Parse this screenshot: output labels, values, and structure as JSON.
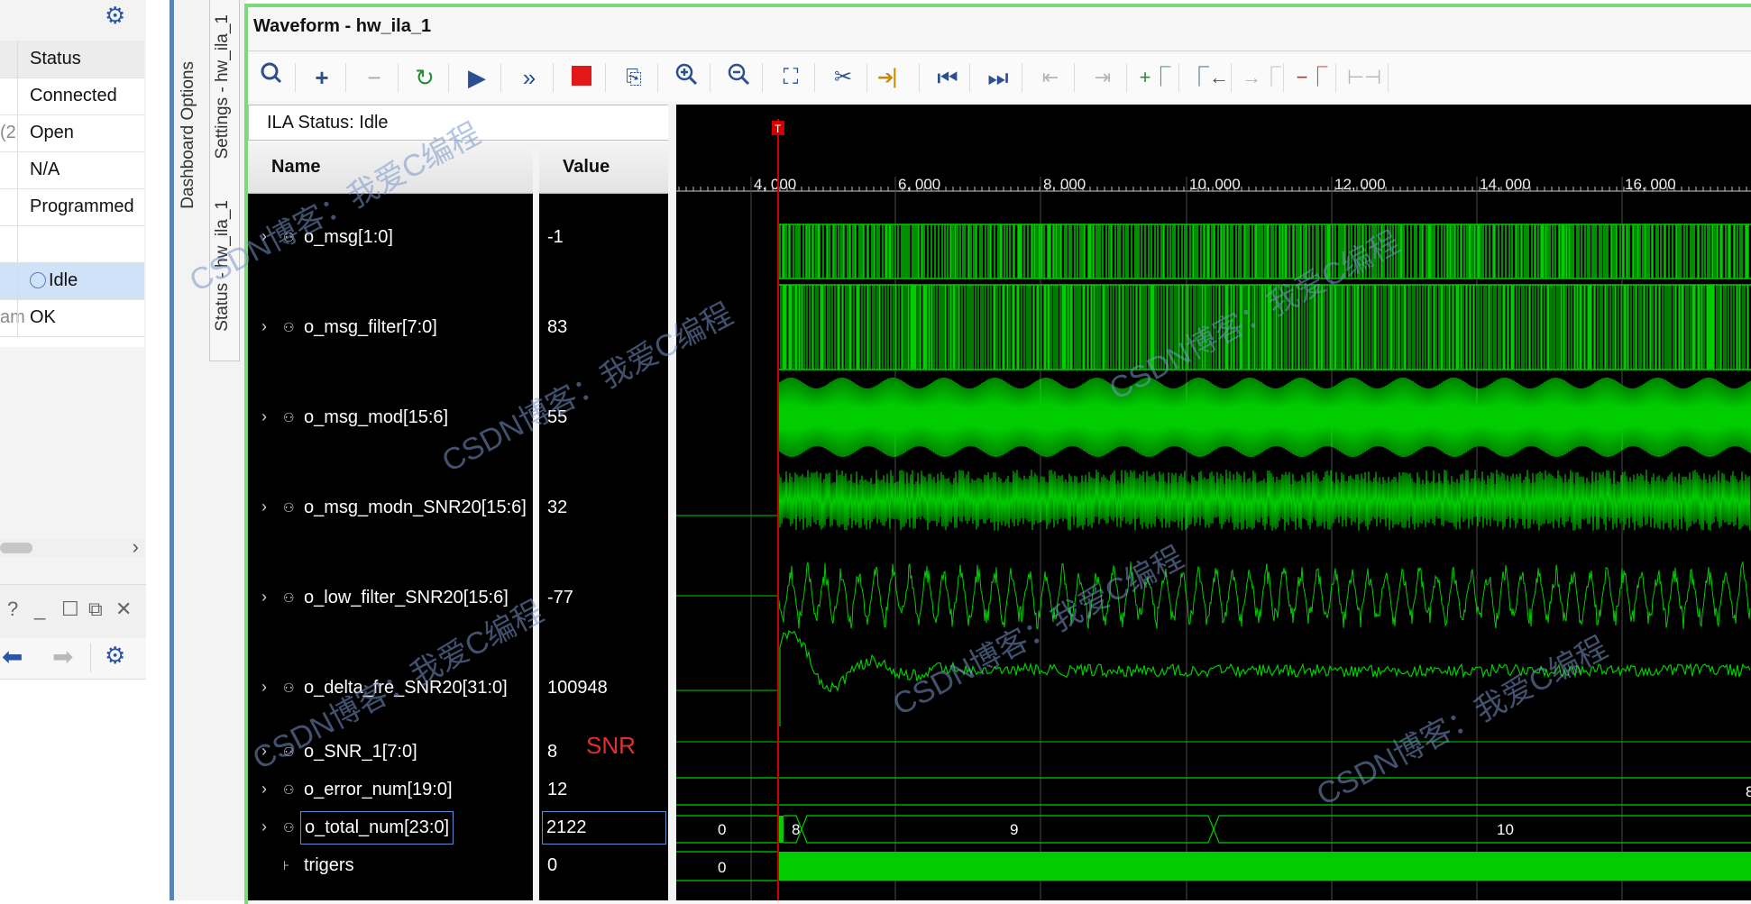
{
  "left_panel": {
    "table_header": "Status",
    "rows": [
      {
        "clipped": "",
        "status": "Connected"
      },
      {
        "clipped": "(2",
        "status": "Open"
      },
      {
        "clipped": "",
        "status": "N/A"
      },
      {
        "clipped": "",
        "status": "Programmed"
      },
      {
        "clipped": "",
        "status": ""
      },
      {
        "clipped": "",
        "status": "Idle"
      },
      {
        "clipped": "am",
        "status": "OK"
      }
    ],
    "window_buttons": [
      "?",
      "_",
      "☐",
      "⧉",
      "✕"
    ]
  },
  "side_tabs": {
    "dashboard_options": "Dashboard Options",
    "settings": "Settings - hw_ila_1",
    "status": "Status - hw_ila_1"
  },
  "waveform": {
    "title": "Waveform - hw_ila_1",
    "ila_status": "ILA Status: Idle",
    "name_header": "Name",
    "value_header": "Value",
    "time_ticks": [
      "4, 000",
      "6, 000",
      "8, 000",
      "10, 000",
      "12, 000",
      "14, 000",
      "16, 000"
    ],
    "trigger_marker": "T",
    "signals": [
      {
        "name": "o_msg[1:0]",
        "value": "-1"
      },
      {
        "name": "o_msg_filter[7:0]",
        "value": "83"
      },
      {
        "name": "o_msg_mod[15:6]",
        "value": "55"
      },
      {
        "name": "o_msg_modn_SNR20[15:6]",
        "value": "32"
      },
      {
        "name": "o_low_filter_SNR20[15:6]",
        "value": "-77"
      },
      {
        "name": "o_delta_fre_SNR20[31:0]",
        "value": "100948"
      },
      {
        "name": "o_SNR_1[7:0]",
        "value": "8"
      },
      {
        "name": "o_error_num[19:0]",
        "value": "12"
      },
      {
        "name": "o_total_num[23:0]",
        "value": "2122"
      },
      {
        "name": "trigers",
        "value": "0"
      }
    ],
    "snr_annotation": "SNR",
    "bus_labels": {
      "snr_right": "8",
      "error_left": "0",
      "error_seg1": "8",
      "error_seg2": "9",
      "error_seg3": "10",
      "total_left": "0"
    }
  },
  "watermark_text": "CSDN博客：我爱C编程",
  "colors": {
    "wave_green": "#00cc00",
    "cursor_red": "#d00000",
    "grid": "#4a4a4a"
  }
}
